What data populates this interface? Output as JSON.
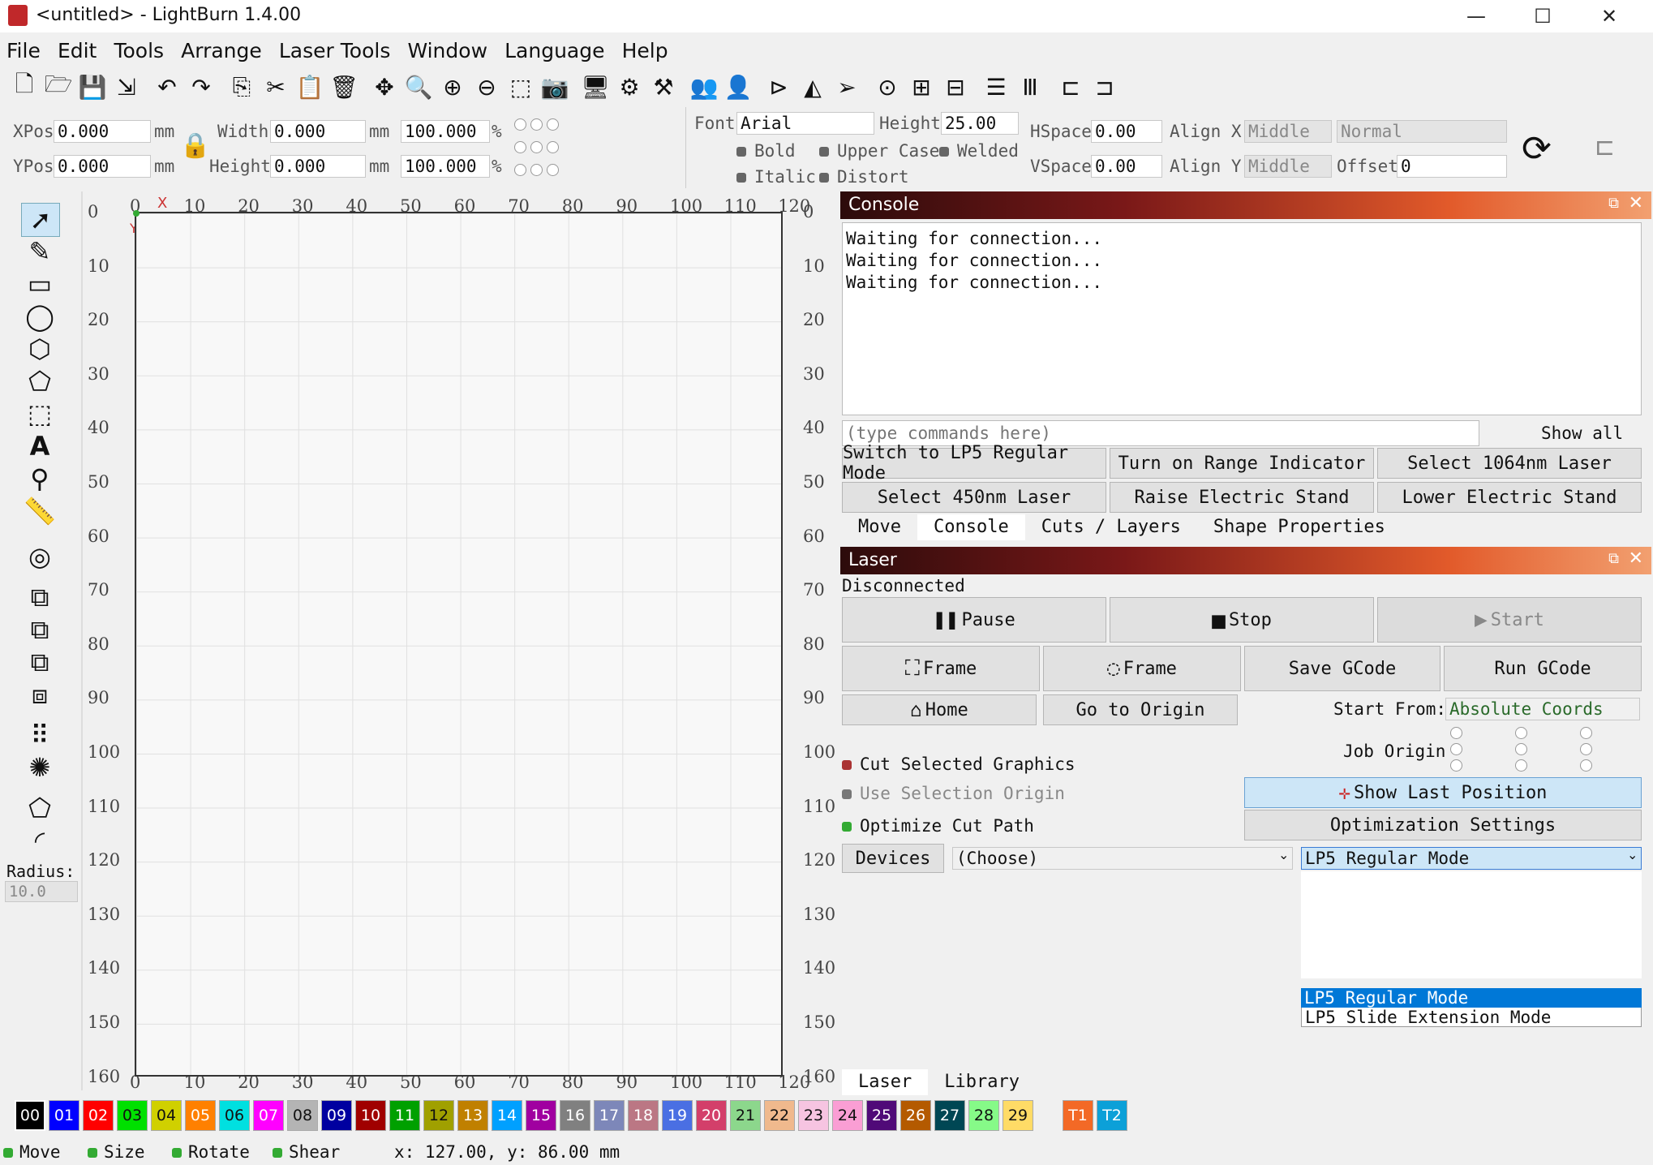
{
  "window": {
    "title": "<untitled> - LightBurn 1.4.00",
    "minimize": "—",
    "maximize": "☐",
    "close": "✕"
  },
  "menu": [
    "File",
    "Edit",
    "Tools",
    "Arrange",
    "Laser Tools",
    "Window",
    "Language",
    "Help"
  ],
  "toolbar_icons": [
    "new-file",
    "open",
    "save",
    "import",
    "undo",
    "redo",
    "copy",
    "cut",
    "paste",
    "delete",
    "move",
    "zoom-fit",
    "zoom-in",
    "zoom-out",
    "zoom-frame",
    "camera",
    "monitor",
    "settings",
    "tools",
    "group",
    "user",
    "mirror-h",
    "mirror-v",
    "send",
    "target",
    "align-center",
    "align-bottom",
    "distribute-h",
    "distribute-v",
    "dock-left",
    "dock-right"
  ],
  "props": {
    "xpos_label": "XPos",
    "xpos": "0.000",
    "ypos_label": "YPos",
    "ypos": "0.000",
    "unit": "mm",
    "width_label": "Width",
    "width": "0.000",
    "height_label": "Height",
    "height": "0.000",
    "scale_x": "100.000",
    "scale_y": "100.000",
    "percent": "%",
    "font_label": "Font",
    "font": "Arial",
    "text_height_label": "Height",
    "text_height": "25.00",
    "bold": "Bold",
    "italic": "Italic",
    "upper_case": "Upper Case",
    "welded": "Welded",
    "distort": "Distort",
    "hspace_label": "HSpace",
    "hspace": "0.00",
    "vspace_label": "VSpace",
    "vspace": "0.00",
    "alignx_label": "Align X",
    "alignx": "Middle",
    "aligny_label": "Align Y",
    "aligny": "Middle",
    "mode": "Normal",
    "offset_label": "Offset",
    "offset": "0"
  },
  "left_tools": {
    "radius_label": "Radius:",
    "radius": "10.0"
  },
  "ruler": {
    "x": [
      "0",
      "10",
      "20",
      "30",
      "40",
      "50",
      "60",
      "70",
      "80",
      "90",
      "100",
      "110",
      "120"
    ],
    "y": [
      "0",
      "10",
      "20",
      "30",
      "40",
      "50",
      "60",
      "70",
      "80",
      "90",
      "100",
      "110",
      "120",
      "130",
      "140",
      "150",
      "160"
    ],
    "x_axis": "X",
    "y_axis": "Y"
  },
  "console": {
    "title": "Console",
    "lines": [
      "Waiting for connection...",
      "Waiting for connection...",
      "Waiting for connection..."
    ],
    "input_placeholder": "(type commands here)",
    "show_all": "Show all",
    "macros": [
      "Switch to LP5 Regular Mode",
      "Turn on Range Indicator",
      "Select 1064nm Laser",
      "Select 450nm Laser",
      "Raise Electric Stand",
      "Lower Electric Stand"
    ],
    "tabs": [
      "Move",
      "Console",
      "Cuts / Layers",
      "Shape Properties"
    ]
  },
  "laser": {
    "title": "Laser",
    "status": "Disconnected",
    "pause": "Pause",
    "stop": "Stop",
    "start": "Start",
    "frame1": "Frame",
    "frame2": "Frame",
    "save_gcode": "Save GCode",
    "run_gcode": "Run GCode",
    "home": "Home",
    "go_origin": "Go to Origin",
    "start_from_label": "Start From:",
    "start_from": "Absolute Coords",
    "job_origin": "Job Origin",
    "cut_selected": "Cut Selected Graphics",
    "use_selection": "Use Selection Origin",
    "optimize": "Optimize Cut Path",
    "show_last": "Show Last Position",
    "opt_settings": "Optimization Settings",
    "devices": "Devices",
    "device": "(Choose)",
    "mode": "LP5 Regular Mode",
    "mode_options": [
      "LP5 Regular Mode",
      "LP5 Slide Extension Mode"
    ],
    "bottom_tabs": [
      "Laser",
      "Library"
    ]
  },
  "palette": [
    "00",
    "01",
    "02",
    "03",
    "04",
    "05",
    "06",
    "07",
    "08",
    "09",
    "10",
    "11",
    "12",
    "13",
    "14",
    "15",
    "16",
    "17",
    "18",
    "19",
    "20",
    "21",
    "22",
    "23",
    "24",
    "25",
    "26",
    "27",
    "28",
    "29",
    "T1",
    "T2"
  ],
  "palette_colors": [
    "#000000",
    "#0000ff",
    "#ff0000",
    "#00e000",
    "#d0d000",
    "#ff8000",
    "#00e0e0",
    "#ff00ff",
    "#b4b4b4",
    "#0000a0",
    "#a00000",
    "#00a000",
    "#a0a000",
    "#c08000",
    "#00a0ff",
    "#a000a0",
    "#808080",
    "#7d87b9",
    "#bb7784",
    "#4a6fe3",
    "#d33f6a",
    "#8cd78c",
    "#f0b98d",
    "#f6c4e1",
    "#fa9ed4",
    "#500a78",
    "#b45a00",
    "#004754",
    "#86fa88",
    "#ffdb66",
    "#f36926",
    "#0ca0d8"
  ],
  "status": {
    "move": "Move",
    "size": "Size",
    "rotate": "Rotate",
    "shear": "Shear",
    "coords": "x: 127.00, y: 86.00 mm"
  }
}
